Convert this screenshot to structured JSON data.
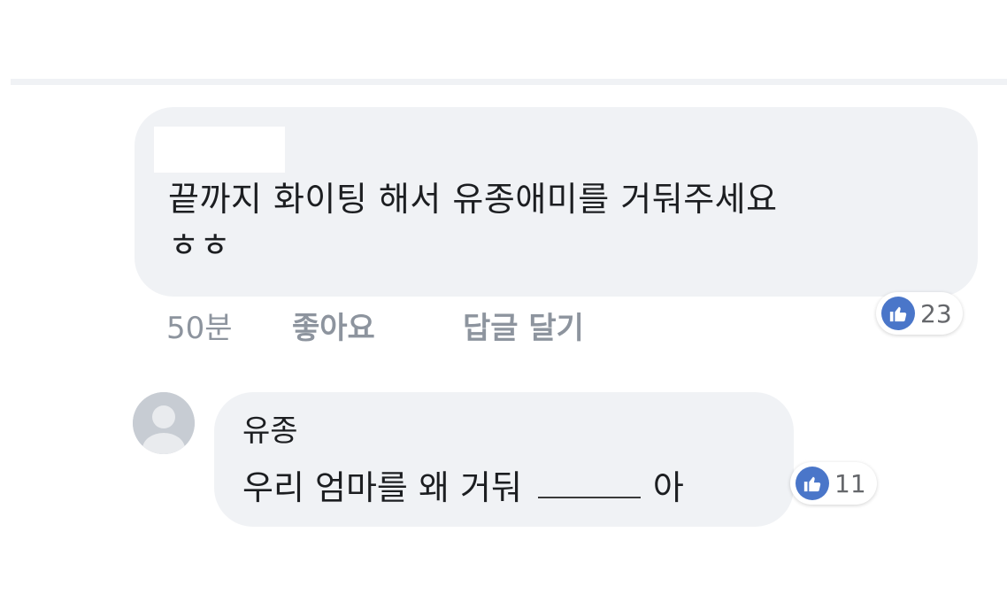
{
  "comment": {
    "text": "끝까지 화이팅 해서 유종애미를 거둬주세요\nㅎㅎ",
    "time": "50분",
    "like_action": "좋아요",
    "reply_action": "답글 달기",
    "like_count": "23"
  },
  "reply": {
    "author": "유종",
    "text_before": "우리 엄마를 왜 거둬",
    "text_after": "아",
    "like_count": "11"
  },
  "colors": {
    "bubble": "#f0f2f5",
    "like_badge": "#4a76c9",
    "muted_text": "#8d949e"
  }
}
